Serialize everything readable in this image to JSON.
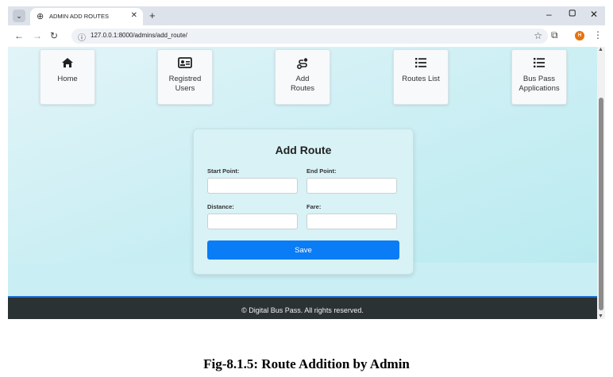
{
  "browser": {
    "tab_title": "ADMIN ADD ROUTES",
    "url": "127.0.0.1:8000/admins/add_route/",
    "profile_initial": "H",
    "icons": {
      "tab_switch": "chevron-down-icon",
      "favicon": "globe-icon",
      "close_tab": "close-icon",
      "new_tab": "plus-icon",
      "back": "back-arrow-icon",
      "forward": "forward-arrow-icon",
      "reload": "reload-icon",
      "site_info": "info-icon",
      "bookmark": "star-icon",
      "extensions": "puzzle-icon",
      "menu": "kebab-menu-icon"
    }
  },
  "nav": {
    "items": [
      {
        "label": "Home",
        "icon": "home-icon"
      },
      {
        "label": "Registred\nUsers",
        "icon": "id-card-icon"
      },
      {
        "label": "Add\nRoutes",
        "icon": "route-icon"
      },
      {
        "label": "Routes List",
        "icon": "list-icon"
      },
      {
        "label": "Bus Pass\nApplications",
        "icon": "list-icon"
      }
    ]
  },
  "form": {
    "title": "Add Route",
    "start_label": "Start Point:",
    "end_label": "End Point:",
    "distance_label": "Distance:",
    "fare_label": "Fare:",
    "start_value": "",
    "end_value": "",
    "distance_value": "",
    "fare_value": "",
    "save_label": "Save"
  },
  "footer": {
    "text": "© Digital Bus Pass. All rights reserved."
  },
  "caption": "Fig-8.1.5: Route Addition by Admin",
  "colors": {
    "accent": "#0a7cf5",
    "footer_bg": "#2b3234",
    "page_bg": "#c7eef3"
  }
}
